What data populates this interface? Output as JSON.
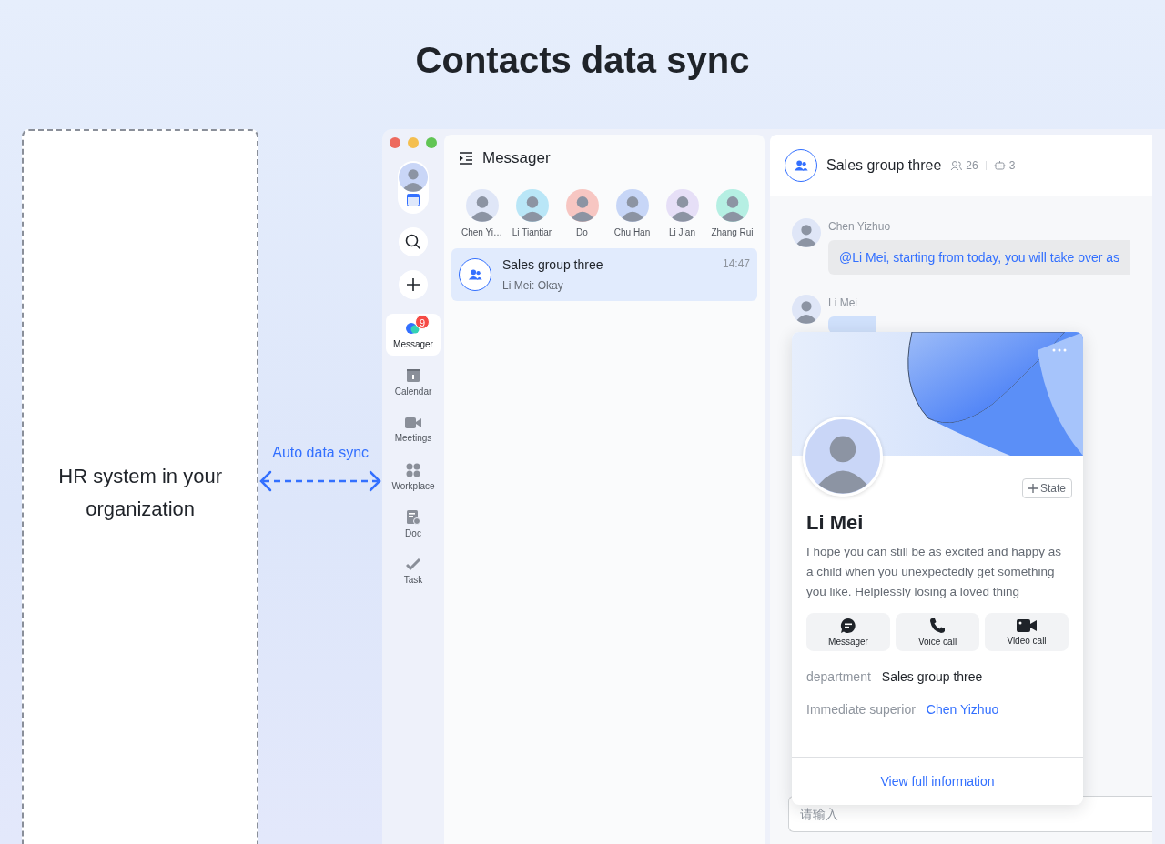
{
  "headline": "Contacts data sync",
  "hr_box": {
    "label": "HR system in your organization"
  },
  "sync": {
    "label": "Auto data sync"
  },
  "app": {
    "nav": [
      {
        "label": "Messager",
        "kind": "messager",
        "selected": true,
        "badge": "9"
      },
      {
        "label": "Calendar",
        "kind": "calendar",
        "selected": false
      },
      {
        "label": "Meetings",
        "kind": "meetings",
        "selected": false
      },
      {
        "label": "Workplace",
        "kind": "workplace",
        "selected": false
      },
      {
        "label": "Doc",
        "kind": "doc",
        "selected": false
      },
      {
        "label": "Task",
        "kind": "task",
        "selected": false
      }
    ],
    "messenger": {
      "title": "Messager",
      "contacts": [
        {
          "name": "Chen Yi…",
          "color": "#dfe6f7"
        },
        {
          "name": "Li Tiantiar",
          "color": "#b9e6f7"
        },
        {
          "name": "Do",
          "color": "#f7c6c2"
        },
        {
          "name": "Chu Han",
          "color": "#c7d6f7"
        },
        {
          "name": "Li Jian",
          "color": "#e6dff7"
        },
        {
          "name": "Zhang Rui",
          "color": "#b5efe3"
        }
      ],
      "chats": [
        {
          "title": "Sales group three",
          "preview": "Li Mei: Okay",
          "time": "14:47",
          "selected": true
        }
      ]
    },
    "chat": {
      "title": "Sales group three",
      "member_count": "26",
      "bot_count": "3",
      "messages": [
        {
          "sender": "Chen Yizhuo",
          "kind": "text",
          "text": "@Li Mei, starting from today, you will take over as"
        },
        {
          "sender": "Li Mei",
          "kind": "covered"
        }
      ],
      "input": {
        "placeholder": "请输入"
      }
    }
  },
  "profile_card": {
    "name": "Li Mei",
    "state_button": "State",
    "bio": "I hope you can still be as excited and happy as a child when you unexpectedly get something you like. Helplessly losing a loved thing",
    "actions": [
      {
        "label": "Messager",
        "kind": "message"
      },
      {
        "label": "Voice call",
        "kind": "voice"
      },
      {
        "label": "Video call",
        "kind": "video"
      }
    ],
    "fields": [
      {
        "label": "department",
        "value": "Sales group three",
        "kind": "text"
      },
      {
        "label": "Immediate superior",
        "value": "Chen Yizhuo",
        "kind": "link"
      }
    ],
    "footer_link": "View full information"
  }
}
